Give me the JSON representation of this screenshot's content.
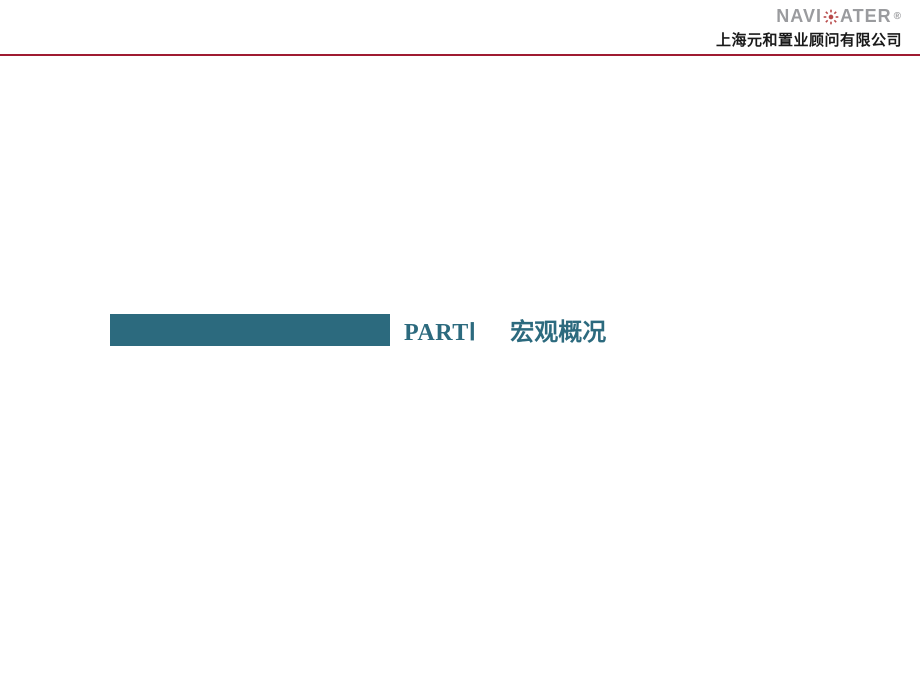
{
  "header": {
    "logo_prefix": "NAVI",
    "logo_suffix": "ATER",
    "logo_reg": "®",
    "company_name": "上海元和置业顾问有限公司"
  },
  "section": {
    "part_label": "PARTⅠ",
    "part_title": "宏观概况"
  },
  "colors": {
    "accent_teal": "#2c6a7e",
    "divider_red": "#9f1b31",
    "logo_gray": "#9a9b9e"
  }
}
